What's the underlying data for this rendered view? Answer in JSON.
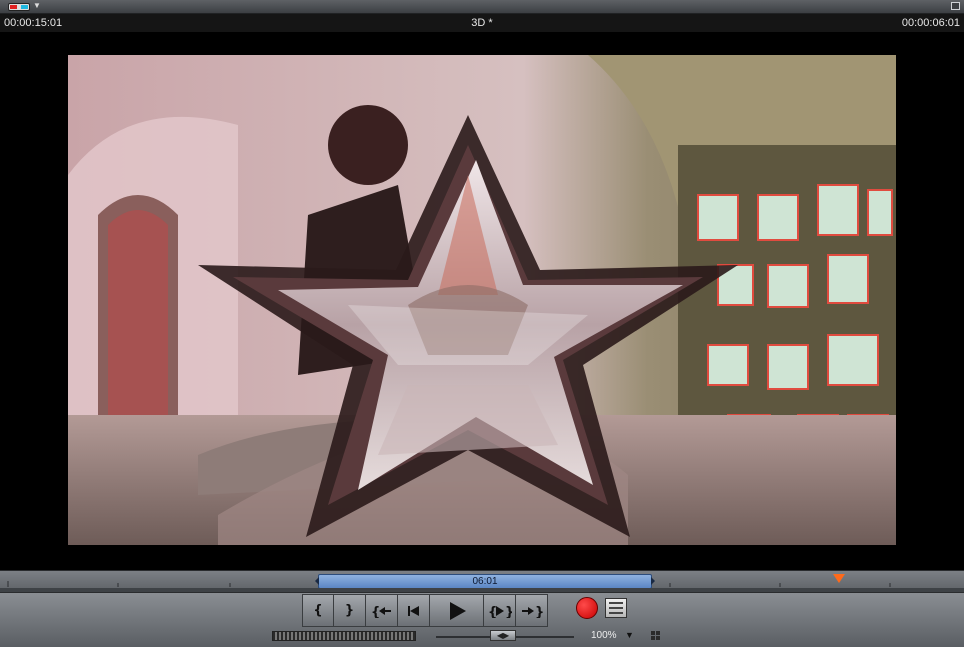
{
  "titlebar": {
    "stereo_icon": "anaglyph-glasses-icon",
    "maximize_icon": "maximize-icon"
  },
  "infobar": {
    "timecode_current": "00:00:15:01",
    "project_title": "3D *",
    "timecode_duration": "00:00:06:01"
  },
  "viewer": {
    "content": "anaglyph 3D video frame with star-shaped overlay"
  },
  "timeline": {
    "range_label": "06:01",
    "range_color": "#6f98d3",
    "playhead_color": "#ff6a1a"
  },
  "transport": {
    "mark_in_label": "{",
    "mark_out_label": "}",
    "go_to_in_icon": "go-to-mark-in-icon",
    "prev_frame_icon": "step-back-icon",
    "play_icon": "play-icon",
    "play_range_icon": "play-in-to-out-icon",
    "go_to_out_icon": "go-to-mark-out-icon",
    "record_icon": "record-icon",
    "record_color": "#e00000",
    "menu_icon": "menu-icon"
  },
  "zoom": {
    "level_label": "100%",
    "caret": "▼"
  }
}
